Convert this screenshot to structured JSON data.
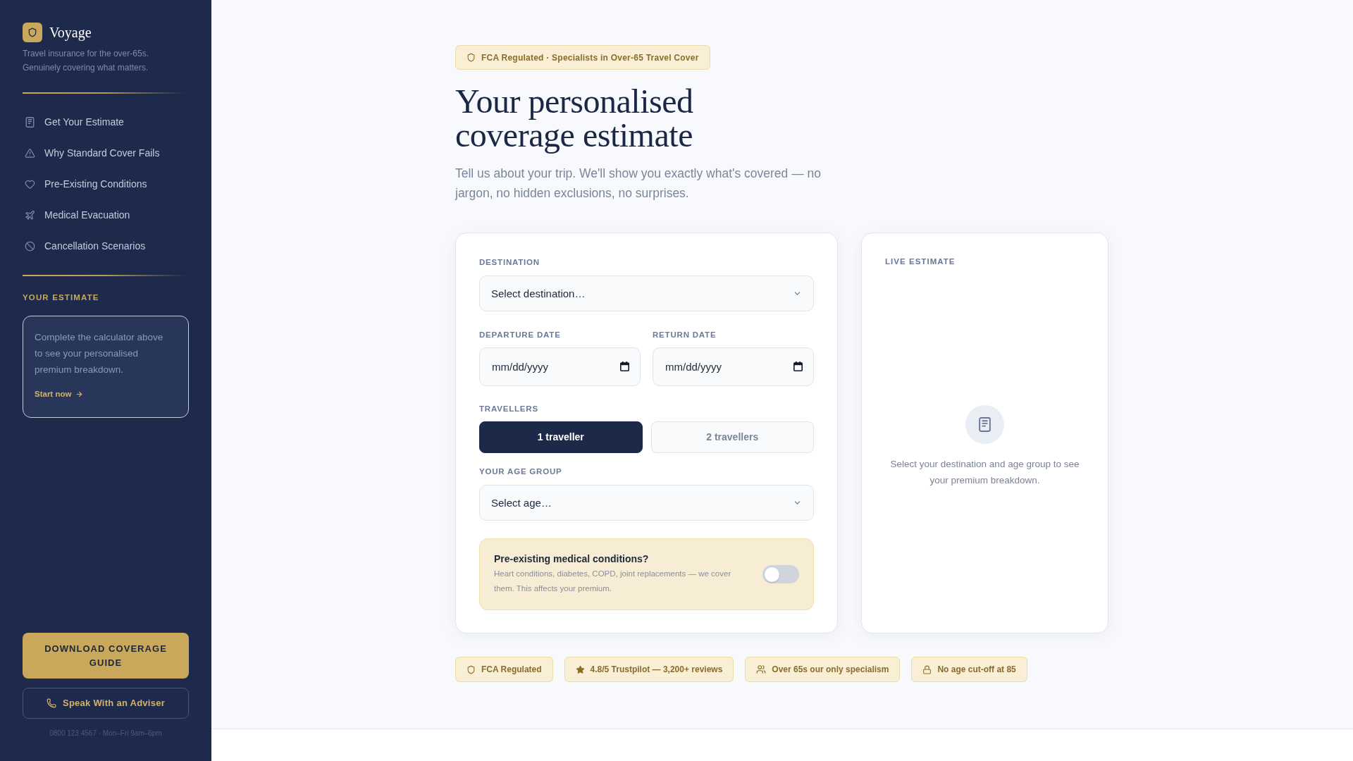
{
  "sidebar": {
    "brand": {
      "name": "Voyage",
      "tagline": "Travel insurance for the over-65s. Genuinely covering what matters."
    },
    "nav": [
      "Get Your Estimate",
      "Why Standard Cover Fails",
      "Pre-Existing Conditions",
      "Medical Evacuation",
      "Cancellation Scenarios"
    ],
    "estimate": {
      "heading": "YOUR ESTIMATE",
      "message": "Complete the calculator above to see your personalised premium breakdown.",
      "link": "Start now"
    },
    "download_button": "DOWNLOAD COVERAGE GUIDE",
    "adviser_button": "Speak With an Adviser",
    "contact": "0800 123 4567 · Mon–Fri 9am–6pm"
  },
  "main": {
    "badge": "FCA Regulated · Specialists in Over-65 Travel Cover",
    "title": "Your personalised coverage estimate",
    "subtitle": "Tell us about your trip. We'll show you exactly what's covered — no jargon, no hidden exclusions, no surprises.",
    "form": {
      "destination": {
        "label": "DESTINATION",
        "placeholder": "Select destination…"
      },
      "dates": [
        {
          "label": "DEPARTURE DATE",
          "placeholder": "mm/dd/yyyy"
        },
        {
          "label": "RETURN DATE",
          "placeholder": "mm/dd/yyyy"
        }
      ],
      "travellers": {
        "label": "TRAVELLERS",
        "options": [
          {
            "label": "1 traveller",
            "selected": true
          },
          {
            "label": "2 travellers",
            "selected": false
          }
        ]
      },
      "age_group": {
        "label": "YOUR AGE GROUP",
        "placeholder": "Select age…"
      },
      "medical": {
        "title": "Pre-existing medical conditions?",
        "description": "Heart conditions, diabetes, COPD, joint replacements — we cover them. This affects your premium.",
        "on": false
      }
    },
    "live_estimate": {
      "heading": "LIVE ESTIMATE",
      "message": "Select your destination and age group to see your premium breakdown."
    },
    "trust_badges": [
      "FCA Regulated",
      "4.8/5 Trustpilot — 3,200+ reviews",
      "Over 65s our only specialism",
      "No age cut-off at 85"
    ]
  }
}
